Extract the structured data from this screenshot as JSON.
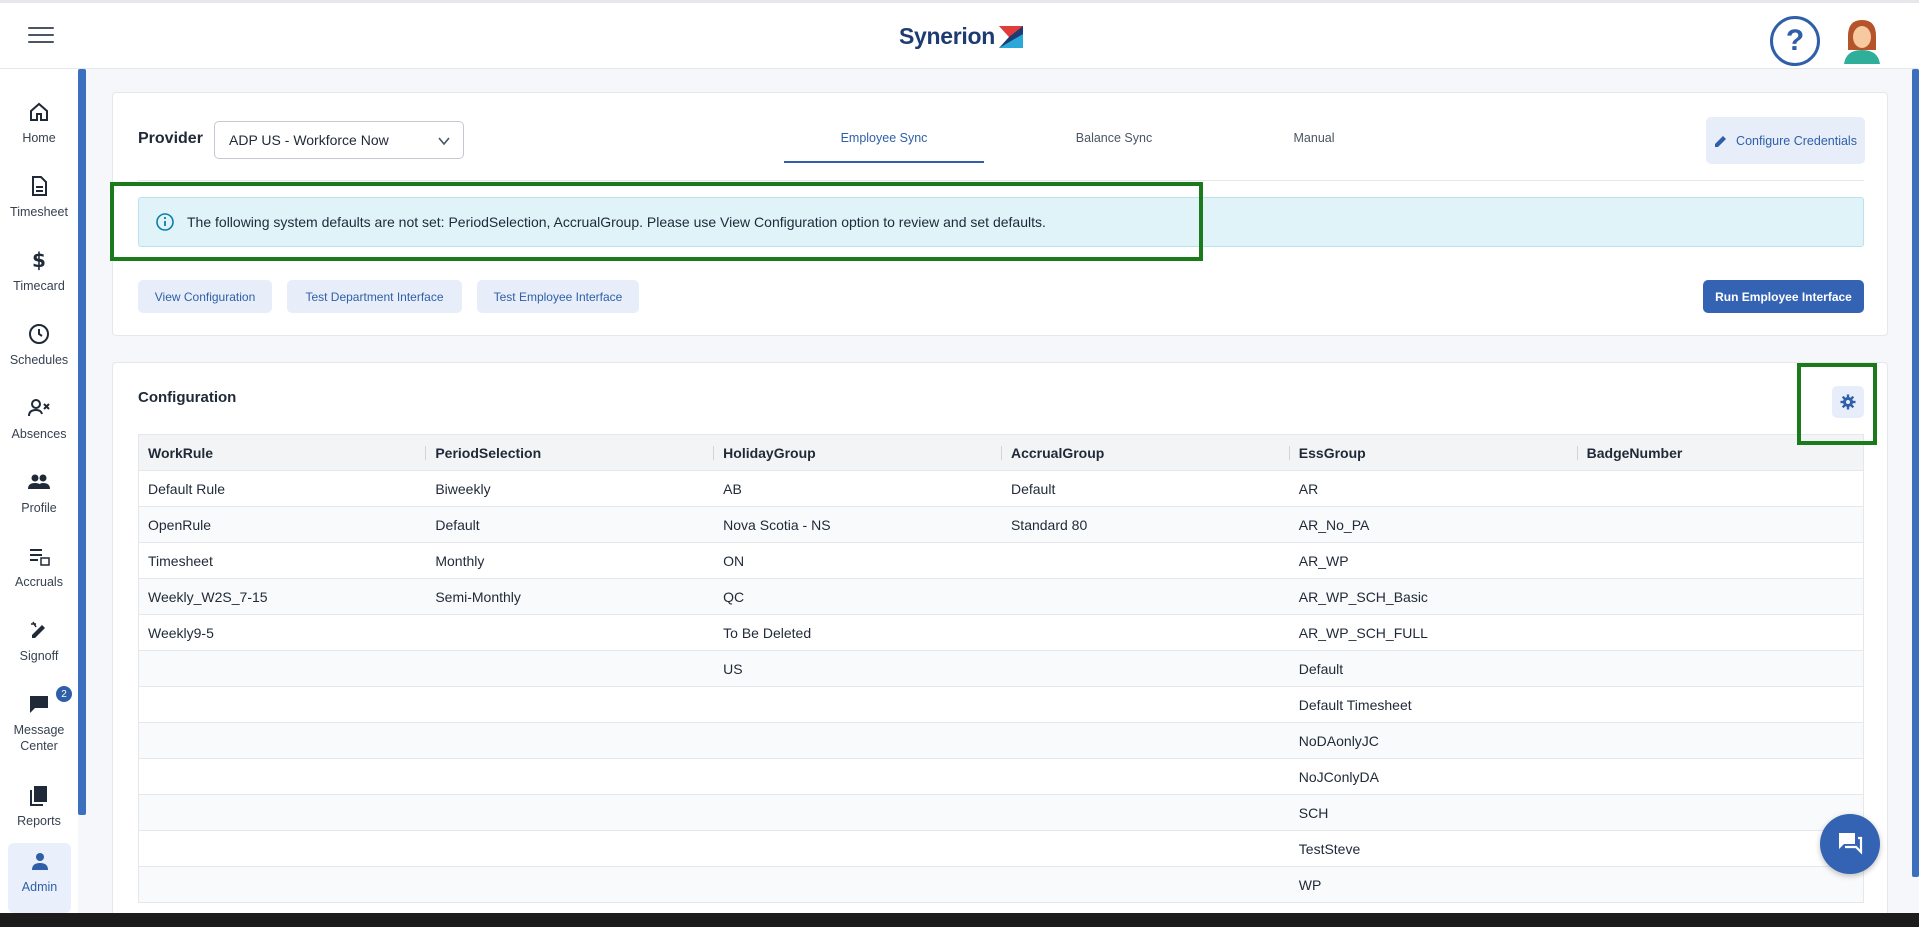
{
  "app": {
    "logo_text": "Synerion",
    "help_label": "?"
  },
  "sidebar": {
    "items": [
      {
        "label": "Home",
        "icon": "home-icon"
      },
      {
        "label": "Timesheet",
        "icon": "document-icon"
      },
      {
        "label": "Timecard",
        "icon": "dollar-icon"
      },
      {
        "label": "Schedules",
        "icon": "clock-icon"
      },
      {
        "label": "Absences",
        "icon": "person-x-icon"
      },
      {
        "label": "Profile",
        "icon": "people-icon"
      },
      {
        "label": "Accruals",
        "icon": "accruals-icon"
      },
      {
        "label": "Signoff",
        "icon": "signoff-icon"
      },
      {
        "label": "Message Center",
        "icon": "message-icon",
        "badge": "2"
      },
      {
        "label": "Reports",
        "icon": "reports-icon"
      },
      {
        "label": "Admin",
        "icon": "admin-person-icon",
        "active": true
      }
    ]
  },
  "provider": {
    "label": "Provider",
    "selected": "ADP US - Workforce Now"
  },
  "tabs": [
    {
      "label": "Employee Sync",
      "active": true
    },
    {
      "label": "Balance Sync"
    },
    {
      "label": "Manual"
    }
  ],
  "configure_credentials": "Configure Credentials",
  "alert": {
    "text": "The following system defaults are not set: PeriodSelection, AccrualGroup. Please use View Configuration option to review and set defaults."
  },
  "actions": {
    "view_configuration": "View Configuration",
    "test_department": "Test Department Interface",
    "test_employee": "Test Employee Interface",
    "run_employee": "Run Employee Interface"
  },
  "configuration": {
    "title": "Configuration",
    "columns": [
      "WorkRule",
      "PeriodSelection",
      "HolidayGroup",
      "AccrualGroup",
      "EssGroup",
      "BadgeNumber"
    ],
    "rows": [
      [
        "Default Rule",
        "Biweekly",
        "AB",
        "Default",
        "AR",
        ""
      ],
      [
        "OpenRule",
        "Default",
        "Nova Scotia - NS",
        "Standard 80",
        "AR_No_PA",
        ""
      ],
      [
        "Timesheet",
        "Monthly",
        "ON",
        "",
        "AR_WP",
        ""
      ],
      [
        "Weekly_W2S_7-15",
        "Semi-Monthly",
        "QC",
        "",
        "AR_WP_SCH_Basic",
        ""
      ],
      [
        "Weekly9-5",
        "",
        "To Be Deleted",
        "",
        "AR_WP_SCH_FULL",
        ""
      ],
      [
        "",
        "",
        "US",
        "",
        "Default",
        ""
      ],
      [
        "",
        "",
        "",
        "",
        "Default Timesheet",
        ""
      ],
      [
        "",
        "",
        "",
        "",
        "NoDAonlyJC",
        ""
      ],
      [
        "",
        "",
        "",
        "",
        "NoJConlyDA",
        ""
      ],
      [
        "",
        "",
        "",
        "",
        "SCH",
        ""
      ],
      [
        "",
        "",
        "",
        "",
        "TestSteve",
        ""
      ],
      [
        "",
        "",
        "",
        "",
        "WP",
        ""
      ]
    ]
  },
  "colors": {
    "accent": "#2f5fa8",
    "primary_button": "#3563b3",
    "highlight": "#1b7a1b",
    "alert_bg": "#dff3f9"
  }
}
